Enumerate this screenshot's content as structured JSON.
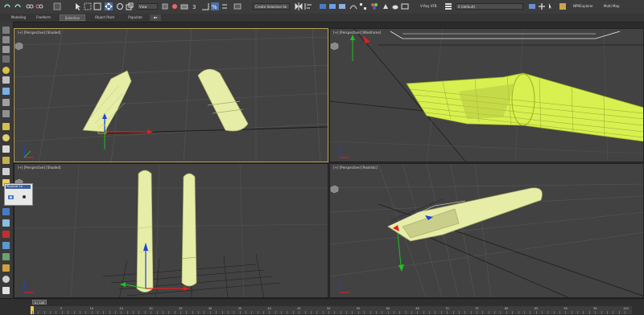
{
  "toolbar": {
    "selection_filter": "View",
    "create_selection_set": "Create Selection Se",
    "vray_label": "V-Ray VFB",
    "material_dropdown": "0 (default)",
    "explorer_tab": "NPRExplorer",
    "multimap_tab": "Multi Map"
  },
  "ribbon": {
    "tabs": [
      {
        "label": "Modeling"
      },
      {
        "label": "Freeform"
      },
      {
        "label": "Selection"
      },
      {
        "label": "Object Paint"
      },
      {
        "label": "Populate"
      }
    ],
    "active_tab": "Selection"
  },
  "viewports": [
    {
      "label": "[+] [Perspective] [Shaded]",
      "active": true
    },
    {
      "label": "[+] [Perspective] [Wireframe]",
      "active": false
    },
    {
      "label": "[+] [Perspective] [Shaded]",
      "active": false
    },
    {
      "label": "[+] [Perspective] [Realistic]",
      "active": false
    }
  ],
  "popup": {
    "title": "Physical Ca"
  },
  "timeline": {
    "frame_counter": "0 / 100",
    "ticks": [
      "0",
      "5",
      "10",
      "15",
      "20",
      "25",
      "30",
      "35",
      "40",
      "45",
      "50",
      "55",
      "60",
      "65",
      "70",
      "75",
      "80",
      "85",
      "90",
      "95",
      "100"
    ]
  },
  "colors": {
    "object_yellow": "#e6eda6",
    "wire_yellow": "#d8f050",
    "active_border": "#b8a150",
    "axis_x": "#e02020",
    "axis_y": "#20c020",
    "axis_z": "#2040e0"
  },
  "icons": [
    "undo-icon",
    "redo-icon",
    "link-icon",
    "unlink-icon",
    "select-icon",
    "move-icon",
    "rotate-icon",
    "scale-icon",
    "snap-icon",
    "mirror-icon",
    "align-icon",
    "render-icon",
    "teapot-icon",
    "camera-icon",
    "light-icon"
  ]
}
